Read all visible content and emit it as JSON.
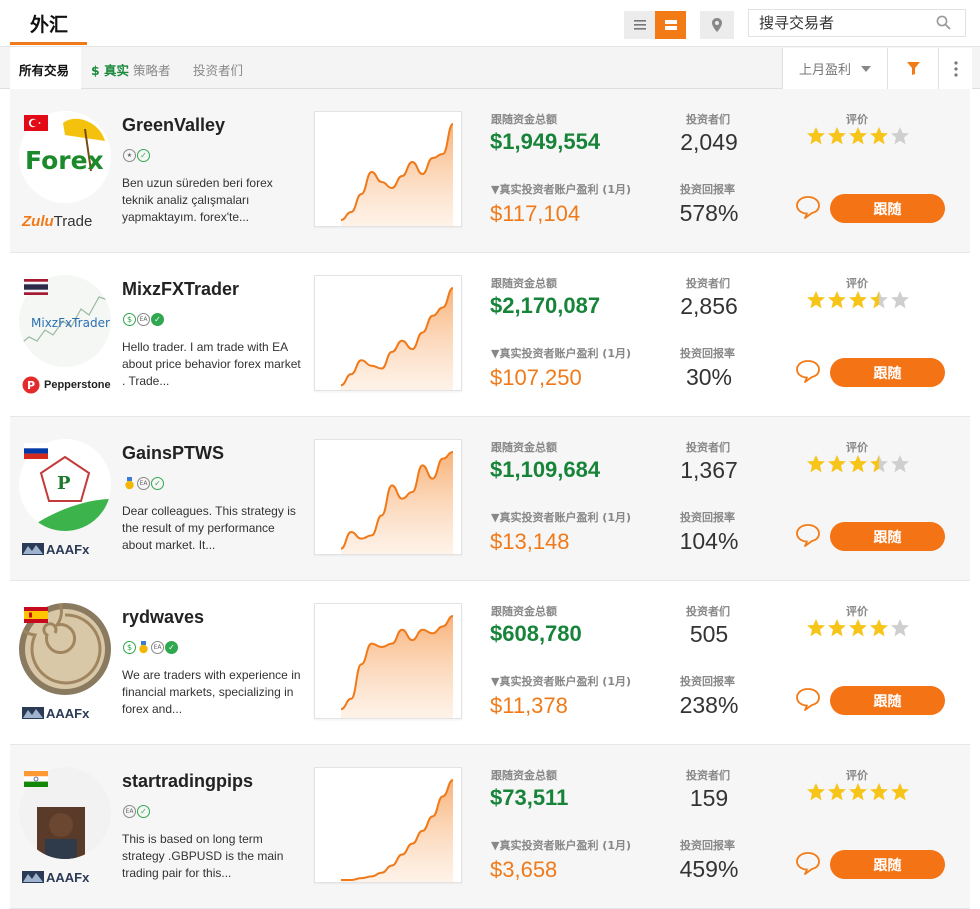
{
  "header": {
    "title": "外汇",
    "search_placeholder": "搜寻交易者"
  },
  "tabs": {
    "all": "所有交易",
    "real_prefix": "$ 真实",
    "real_suffix": "策略者",
    "investors": "投资者们"
  },
  "sort": {
    "selected": "上月盈利"
  },
  "labels": {
    "copy_funds": "跟随资金总额",
    "real_profit": "▼真实投资者账户盈利 (1月)",
    "investors": "投资者们",
    "roi": "投资回报率",
    "rating": "评价",
    "follow": "跟随"
  },
  "colors": {
    "accent": "#f27b16",
    "green": "#17843a",
    "star": "#f7c51a"
  },
  "traders": [
    {
      "name": "GreenValley",
      "flag": "turkey",
      "broker": "ZuluTrade",
      "badges": [
        "star",
        "check"
      ],
      "description": "Ben uzun süreden beri forex teknik analiz çalışmaları yapmaktayım. forex'te...",
      "copy_funds": "$1,949,554",
      "profit": "$117,104",
      "investors": "2,049",
      "roi": "578%",
      "rating": 4,
      "chart": [
        4,
        12,
        30,
        52,
        42,
        36,
        48,
        62,
        50,
        66,
        70,
        100
      ]
    },
    {
      "name": "MixzFXTrader",
      "flag": "thailand",
      "broker": "Pepperstone",
      "badges": [
        "dollar",
        "ea",
        "check-fill"
      ],
      "description": "Hello trader. I am  trade with EA about price behavior  forex market . Trade...",
      "copy_funds": "$2,170,087",
      "profit": "$107,250",
      "investors": "2,856",
      "roi": "30%",
      "rating": 3.5,
      "chart": [
        2,
        10,
        20,
        16,
        14,
        26,
        34,
        28,
        40,
        52,
        58,
        72
      ]
    },
    {
      "name": "GainsPTWS",
      "flag": "russia",
      "broker": "AAAFx",
      "badges": [
        "medal",
        "ea",
        "check"
      ],
      "description": "Dear colleagues. This strategy is the result of my performance about market. It...",
      "copy_funds": "$1,109,684",
      "profit": "$13,148",
      "investors": "1,367",
      "roi": "104%",
      "rating": 3.5,
      "chart": [
        2,
        12,
        8,
        10,
        22,
        40,
        32,
        36,
        52,
        44,
        56,
        60
      ]
    },
    {
      "name": "rydwaves",
      "flag": "spain",
      "broker": "AAAFx",
      "badges": [
        "dollar",
        "medal",
        "ea",
        "check-fill"
      ],
      "description": "We are traders with experience in financial markets, specializing in forex and...",
      "copy_funds": "$608,780",
      "profit": "$11,378",
      "investors": "505",
      "roi": "238%",
      "rating": 4,
      "chart": [
        4,
        10,
        30,
        42,
        40,
        42,
        50,
        44,
        50,
        48,
        52,
        58
      ]
    },
    {
      "name": "startradingpips",
      "flag": "india",
      "broker": "AAAFx",
      "badges": [
        "ea",
        "check"
      ],
      "description": "This is based on long term strategy .GBPUSD is the main trading pair for this...",
      "copy_funds": "$73,511",
      "profit": "$3,658",
      "investors": "159",
      "roi": "459%",
      "rating": 5,
      "chart": [
        0,
        0,
        2,
        4,
        8,
        16,
        28,
        40,
        54,
        70,
        92,
        110
      ]
    }
  ]
}
